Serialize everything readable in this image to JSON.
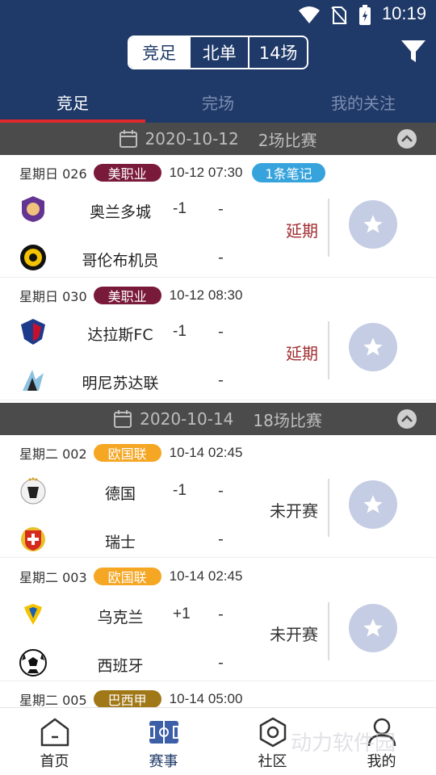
{
  "status": {
    "time": "10:19"
  },
  "header": {
    "segments": [
      "竞足",
      "北单",
      "14场"
    ],
    "tabs": [
      "竞足",
      "完场",
      "我的关注"
    ]
  },
  "groups": [
    {
      "date": "2020-10-12",
      "count": "2场比赛",
      "matches": [
        {
          "code": "星期日 026",
          "league": "美职业",
          "league_color": "#7a1a3a",
          "time": "10-12 07:30",
          "note": "1条笔记",
          "home": "奥兰多城",
          "handicap": "-1",
          "home_score": "-",
          "away": "哥伦布机员",
          "away_score": "-",
          "status": "延期",
          "status_color": "#a12e32"
        },
        {
          "code": "星期日 030",
          "league": "美职业",
          "league_color": "#7a1a3a",
          "time": "10-12 08:30",
          "home": "达拉斯FC",
          "handicap": "-1",
          "home_score": "-",
          "away": "明尼苏达联",
          "away_score": "-",
          "status": "延期",
          "status_color": "#a12e32"
        }
      ]
    },
    {
      "date": "2020-10-14",
      "count": "18场比赛",
      "matches": [
        {
          "code": "星期二 002",
          "league": "欧国联",
          "league_color": "#f5a623",
          "time": "10-14 02:45",
          "home": "德国",
          "handicap": "-1",
          "home_score": "-",
          "away": "瑞士",
          "away_score": "-",
          "status": "未开赛",
          "status_color": "#333333"
        },
        {
          "code": "星期二 003",
          "league": "欧国联",
          "league_color": "#f5a623",
          "time": "10-14 02:45",
          "home": "乌克兰",
          "handicap": "+1",
          "home_score": "-",
          "away": "西班牙",
          "away_score": "-",
          "status": "未开赛",
          "status_color": "#333333"
        },
        {
          "code": "星期二 005",
          "league": "巴西甲",
          "league_color": "#a07818",
          "time": "10-14 05:00"
        }
      ]
    }
  ],
  "bottom_nav": [
    "首页",
    "赛事",
    "社区",
    "我的"
  ],
  "watermark": "动力软件园"
}
